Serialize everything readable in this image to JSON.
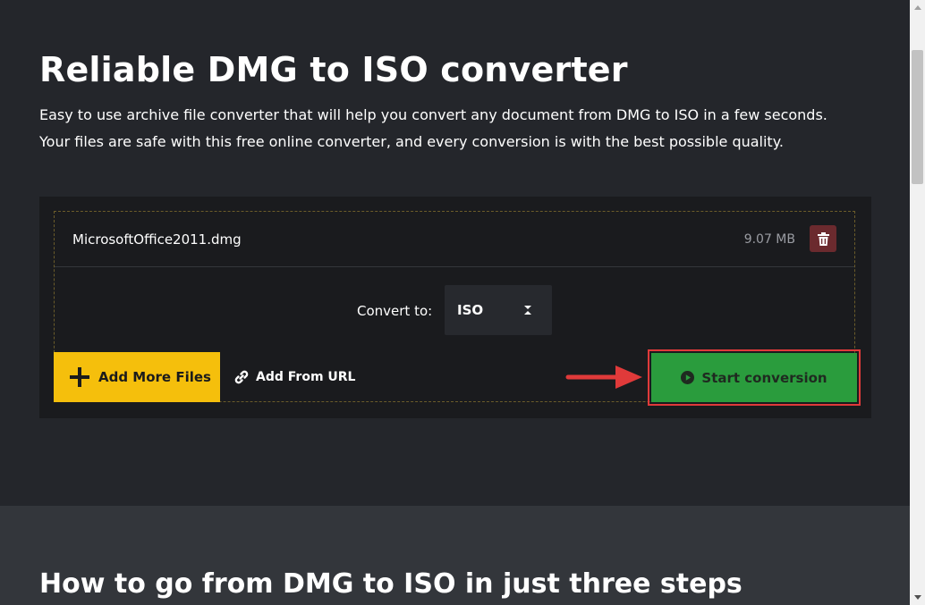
{
  "hero": {
    "title": "Reliable DMG to ISO converter",
    "description_line1": "Easy to use archive file converter that will help you convert any document from DMG to ISO in a few seconds.",
    "description_line2": "Your files are safe with this free online converter, and every conversion is with the best possible quality."
  },
  "converter": {
    "file": {
      "name": "MicrosoftOffice2011.dmg",
      "size": "9.07 MB"
    },
    "convert_label": "Convert to:",
    "target_format": "ISO",
    "add_more_label": "Add More Files",
    "add_url_label": "Add From URL",
    "start_label": "Start conversion"
  },
  "section2": {
    "title": "How to go from DMG to ISO in just three steps"
  },
  "icons": {
    "delete": "trash-icon",
    "add": "plus-icon",
    "url": "link-icon",
    "start": "play-circle-icon",
    "select": "select-arrows-icon"
  },
  "colors": {
    "background": "#24262b",
    "panel": "#1a1b1e",
    "add_button": "#f5bf0c",
    "start_button": "#2a9c3d",
    "delete_button": "#6b2a2e",
    "annotation": "#e03a3a"
  }
}
